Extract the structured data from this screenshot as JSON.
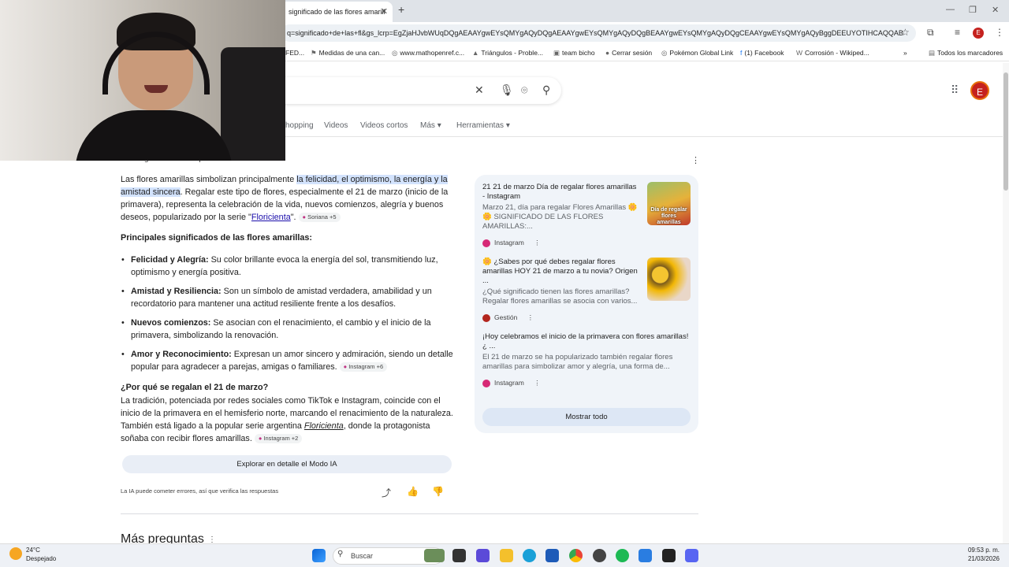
{
  "browser": {
    "tab_title": "significado de las flores amarill",
    "url": "q=significado+de+las+fl&gs_lcrp=EgZjaHJvbWUqDQgAEAAYgwEYsQMYgAQyDQgAEAAYgwEYsQMYgAQyDQgBEAAYgwEYsQMYgAQyDQgCEAAYgwEYsQMYgAQyBggDEEUYOTIHCAQQAB",
    "profile_letter": "E"
  },
  "bookmarks": [
    {
      "label": "FED...",
      "icon": ""
    },
    {
      "label": "Medidas de una can...",
      "icon": "⚑"
    },
    {
      "label": "www.mathopenref.c...",
      "icon": "◎"
    },
    {
      "label": "Triángulos - Proble...",
      "icon": "▲"
    },
    {
      "label": "team bicho",
      "icon": "▣"
    },
    {
      "label": "Cerrar sesión",
      "icon": "●"
    },
    {
      "label": "Pokémon Global Link",
      "icon": "◎"
    },
    {
      "label": "(1) Facebook",
      "icon": "f"
    },
    {
      "label": "Corrosión - Wikiped...",
      "icon": "W"
    },
    {
      "label": "Todos los marcadores",
      "icon": "▤"
    }
  ],
  "search_tabs": [
    "hopping",
    "Videos",
    "Videos cortos",
    "Más",
    "Herramientas"
  ],
  "ai_overview": {
    "label": "Visión general creada por IA",
    "intro_before": "Las flores amarillas simbolizan principalmente ",
    "intro_highlight": "la felicidad, el optimismo, la energía y la amistad sincera",
    "intro_after": ". Regalar este tipo de flores, especialmente el 21 de marzo (inicio de la primavera), representa la celebración de la vida, nuevos comienzos, alegría y buenos deseos, popularizado por la serie \"",
    "intro_link": "Floricienta",
    "intro_end": "\".",
    "intro_chip": "Soriana +5",
    "heading1": "Principales significados de las flores amarillas:",
    "bullets": [
      {
        "term": "Felicidad y Alegría:",
        "text": " Su color brillante evoca la energía del sol, transmitiendo luz, optimismo y energía positiva.",
        "chip": ""
      },
      {
        "term": "Amistad y Resiliencia:",
        "text": " Son un símbolo de amistad verdadera, amabilidad y un recordatorio para mantener una actitud resiliente frente a los desafíos.",
        "chip": ""
      },
      {
        "term": "Nuevos comienzos:",
        "text": " Se asocian con el renacimiento, el cambio y el inicio de la primavera, simbolizando la renovación.",
        "chip": ""
      },
      {
        "term": "Amor y Reconocimiento:",
        "text": " Expresan un amor sincero y admiración, siendo un detalle popular para agradecer a parejas, amigas o familiares.",
        "chip": "Instagram +6"
      }
    ],
    "heading2": "¿Por qué se regalan el 21 de marzo?",
    "para2_before": "La tradición, potenciada por redes sociales como TikTok e Instagram, coincide con el inicio de la primavera en el hemisferio norte, marcando el renacimiento de la naturaleza. También está ligado a la popular serie argentina ",
    "para2_italic": "Floricienta",
    "para2_after": ", donde la protagonista soñaba con recibir flores amarillas.",
    "para2_chip": "Instagram +2",
    "explore_button": "Explorar en detalle el Modo IA",
    "disclaimer": "La IA puede cometer errores, así que verifica las respuestas"
  },
  "sources": [
    {
      "title": "21 21 de marzo Día de regalar flores amarillas - Instagram",
      "desc": "Marzo 21, día para regalar Flores Amarillas 🌼 🌼 SIGNIFICADO DE LAS FLORES AMARILLAS:...",
      "site": "Instagram",
      "site_color": "#d62976",
      "thumb_text": "Día de regalar flores amarillas"
    },
    {
      "title": "🌼 ¿Sabes por qué debes regalar flores amarillas HOY 21 de marzo a tu novia? Origen ...",
      "desc": "¿Qué significado tienen las flores amarillas? Regalar flores amarillas se asocia con varios...",
      "site": "Gestión",
      "site_color": "#b3261e",
      "thumb_text": ""
    },
    {
      "title": "¡Hoy celebramos el inicio de la primavera con flores amarillas! ¿ ...",
      "desc": "El 21 de marzo se ha popularizado también regalar flores amarillas para simbolizar amor y alegría, una forma de...",
      "site": "Instagram",
      "site_color": "#d62976",
      "thumb_text": ""
    }
  ],
  "show_all": "Mostrar todo",
  "more_questions": "Más preguntas",
  "taskbar": {
    "temperature": "24°C",
    "weather": "Despejado",
    "search": "Buscar",
    "time": "09:53 p. m.",
    "date": "21/03/2026"
  }
}
